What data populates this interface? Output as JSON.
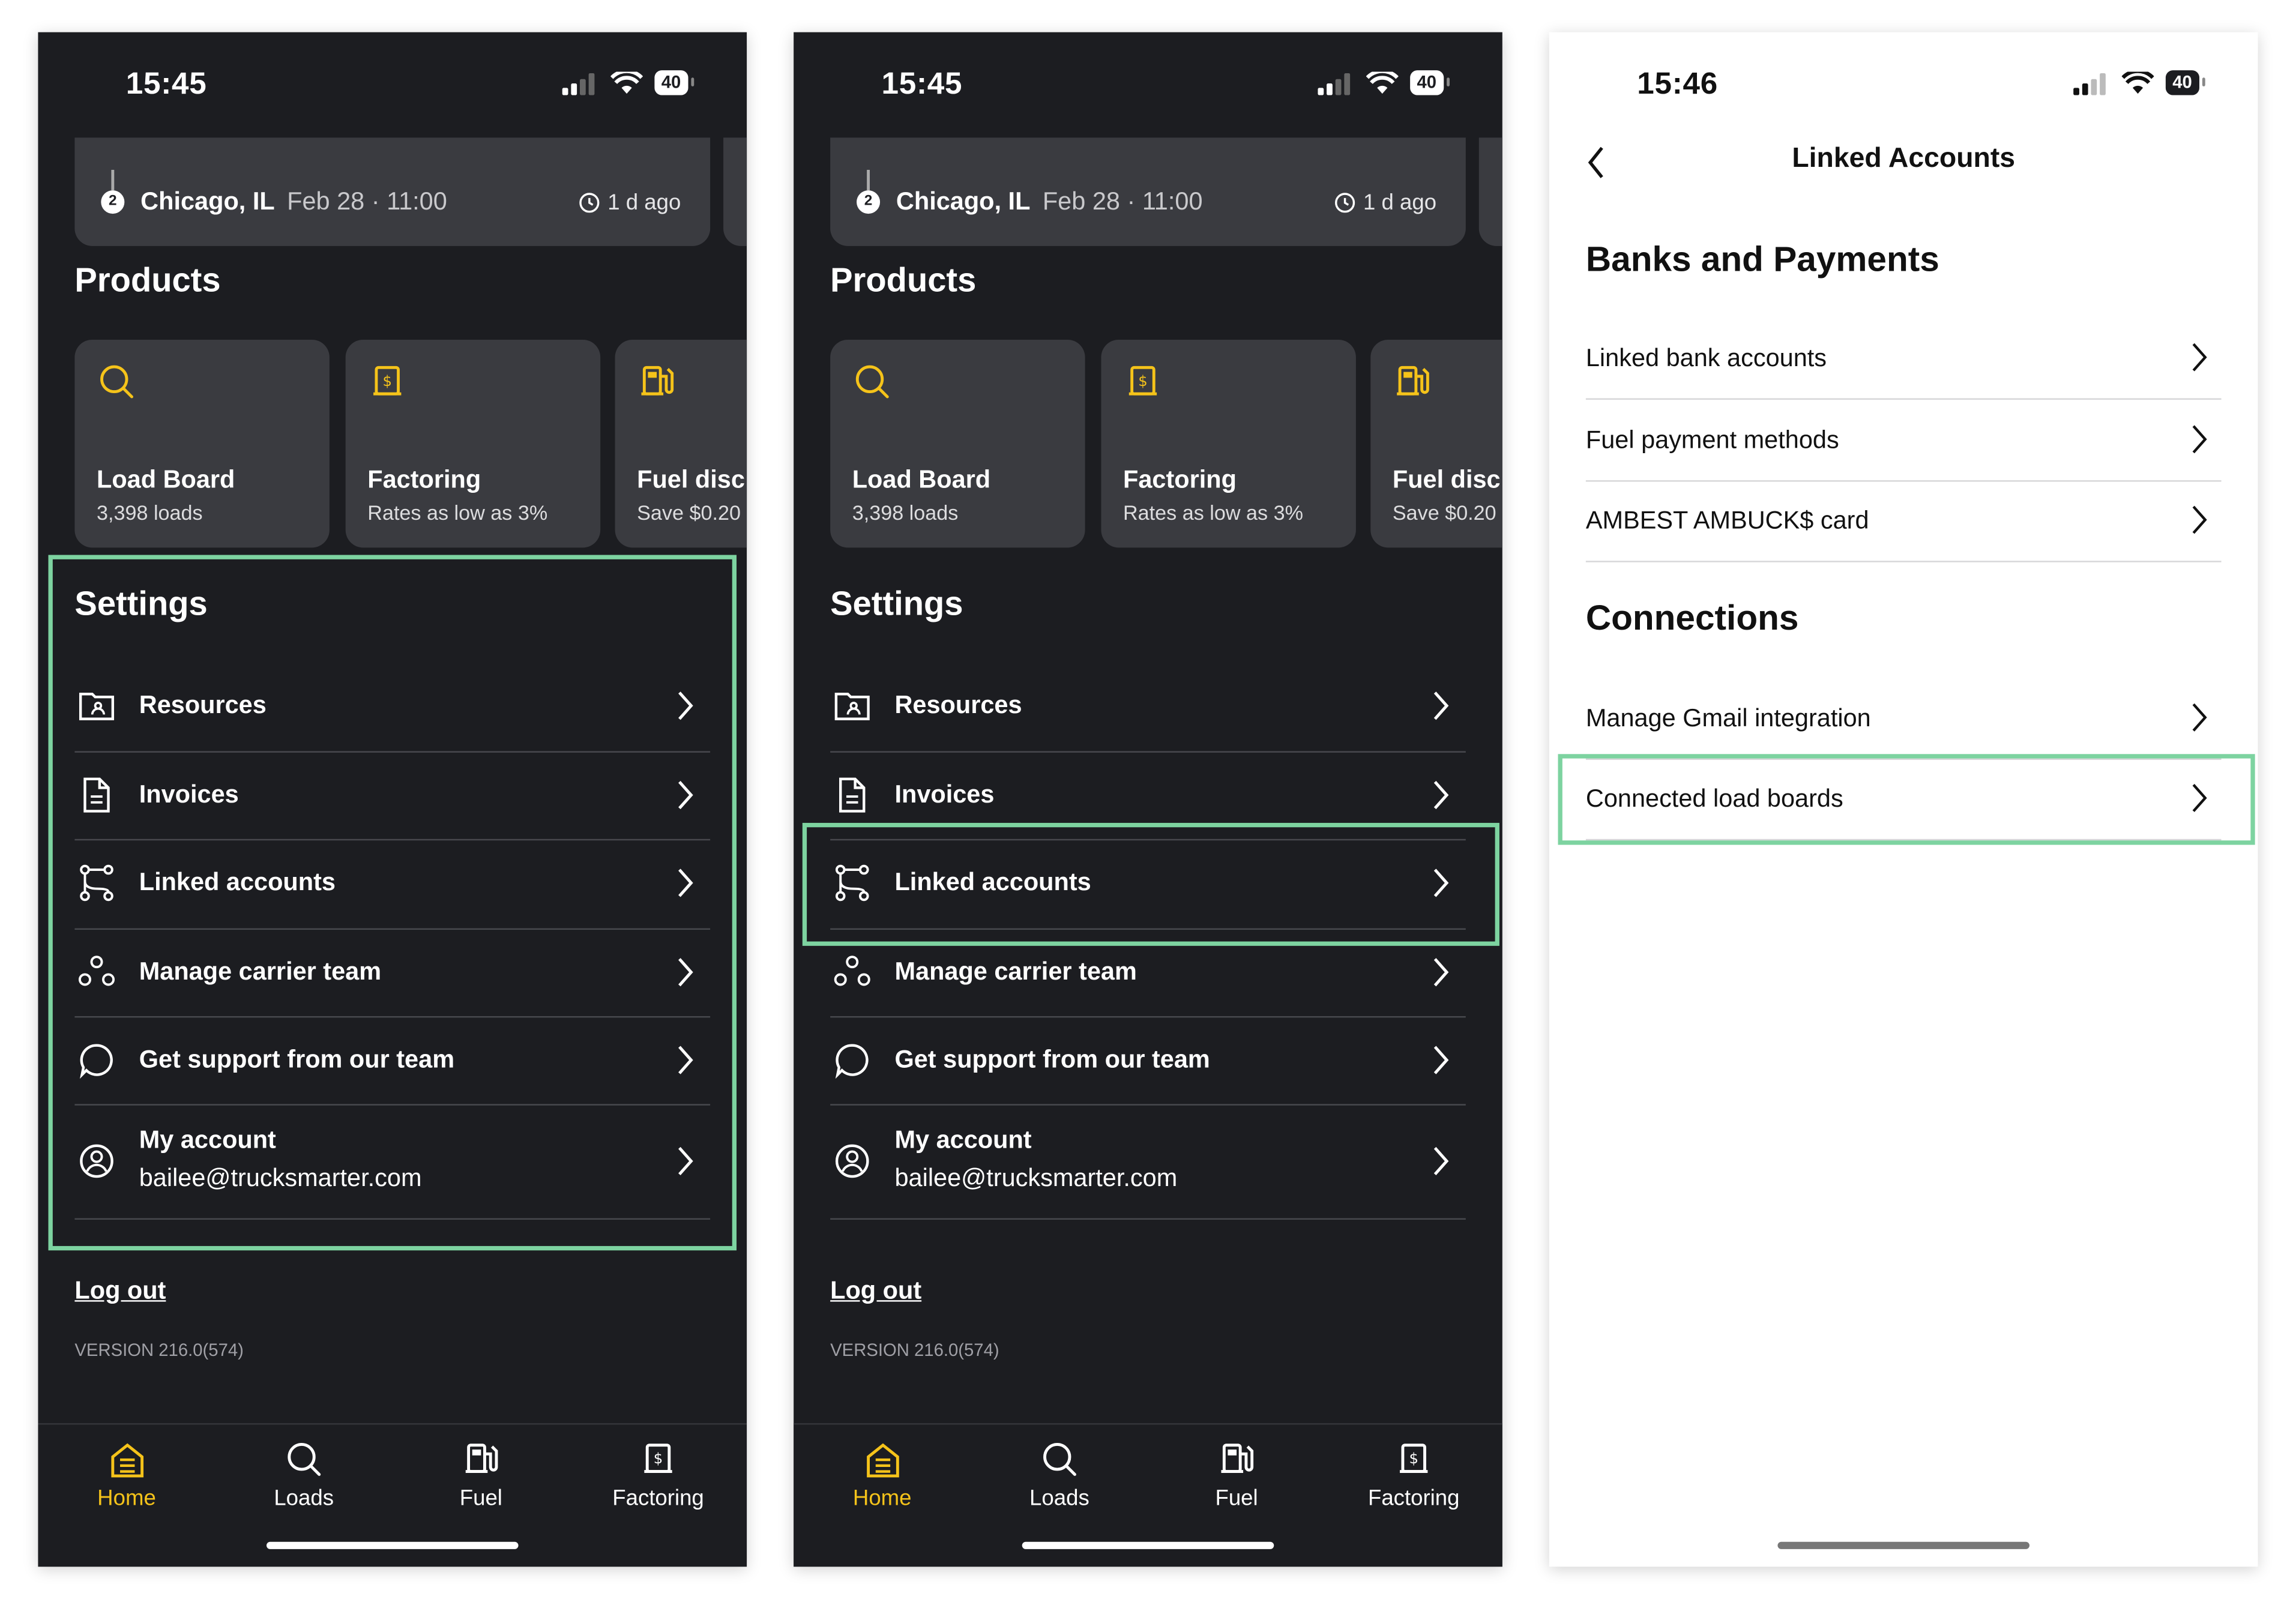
{
  "status_times": [
    "15:45",
    "15:45",
    "15:46"
  ],
  "battery": "40",
  "load_card": {
    "stop_number": "2",
    "city": "Chicago, IL",
    "date": "Feb 28 · 11:00",
    "ago": "1 d ago"
  },
  "products_title": "Products",
  "products": [
    {
      "title": "Load Board",
      "subtitle": "3,398 loads",
      "icon": "search-icon"
    },
    {
      "title": "Factoring",
      "subtitle": "Rates as low as 3%",
      "icon": "receipt-dollar-icon"
    },
    {
      "title": "Fuel disc",
      "subtitle": "Save $0.20",
      "icon": "fuel-pump-icon"
    }
  ],
  "settings_title": "Settings",
  "settings": [
    {
      "label": "Resources",
      "icon": "folder-icon"
    },
    {
      "label": "Invoices",
      "icon": "document-icon"
    },
    {
      "label": "Linked accounts",
      "icon": "link-nodes-icon"
    },
    {
      "label": "Manage carrier team",
      "icon": "team-icon"
    },
    {
      "label": "Get support from our team",
      "icon": "chat-bubble-icon"
    },
    {
      "label": "My account",
      "sub": "bailee@trucksmarter.com",
      "icon": "user-circle-icon"
    }
  ],
  "logout": "Log out",
  "version": "VERSION 216.0(574)",
  "tabs": [
    {
      "label": "Home",
      "icon": "home-icon"
    },
    {
      "label": "Loads",
      "icon": "search-icon"
    },
    {
      "label": "Fuel",
      "icon": "fuel-pump-icon"
    },
    {
      "label": "Factoring",
      "icon": "receipt-dollar-icon"
    }
  ],
  "linked": {
    "title": "Linked Accounts",
    "banks_title": "Banks and Payments",
    "banks": [
      "Linked bank accounts",
      "Fuel payment methods",
      "AMBEST AMBUCK$ card"
    ],
    "connections_title": "Connections",
    "connections": [
      "Manage Gmail integration",
      "Connected load boards"
    ]
  },
  "colors": {
    "accent": "#f5c31a",
    "highlight": "#7dd3a0",
    "dark_bg": "#1c1d21",
    "card_bg": "#3a3b40"
  }
}
